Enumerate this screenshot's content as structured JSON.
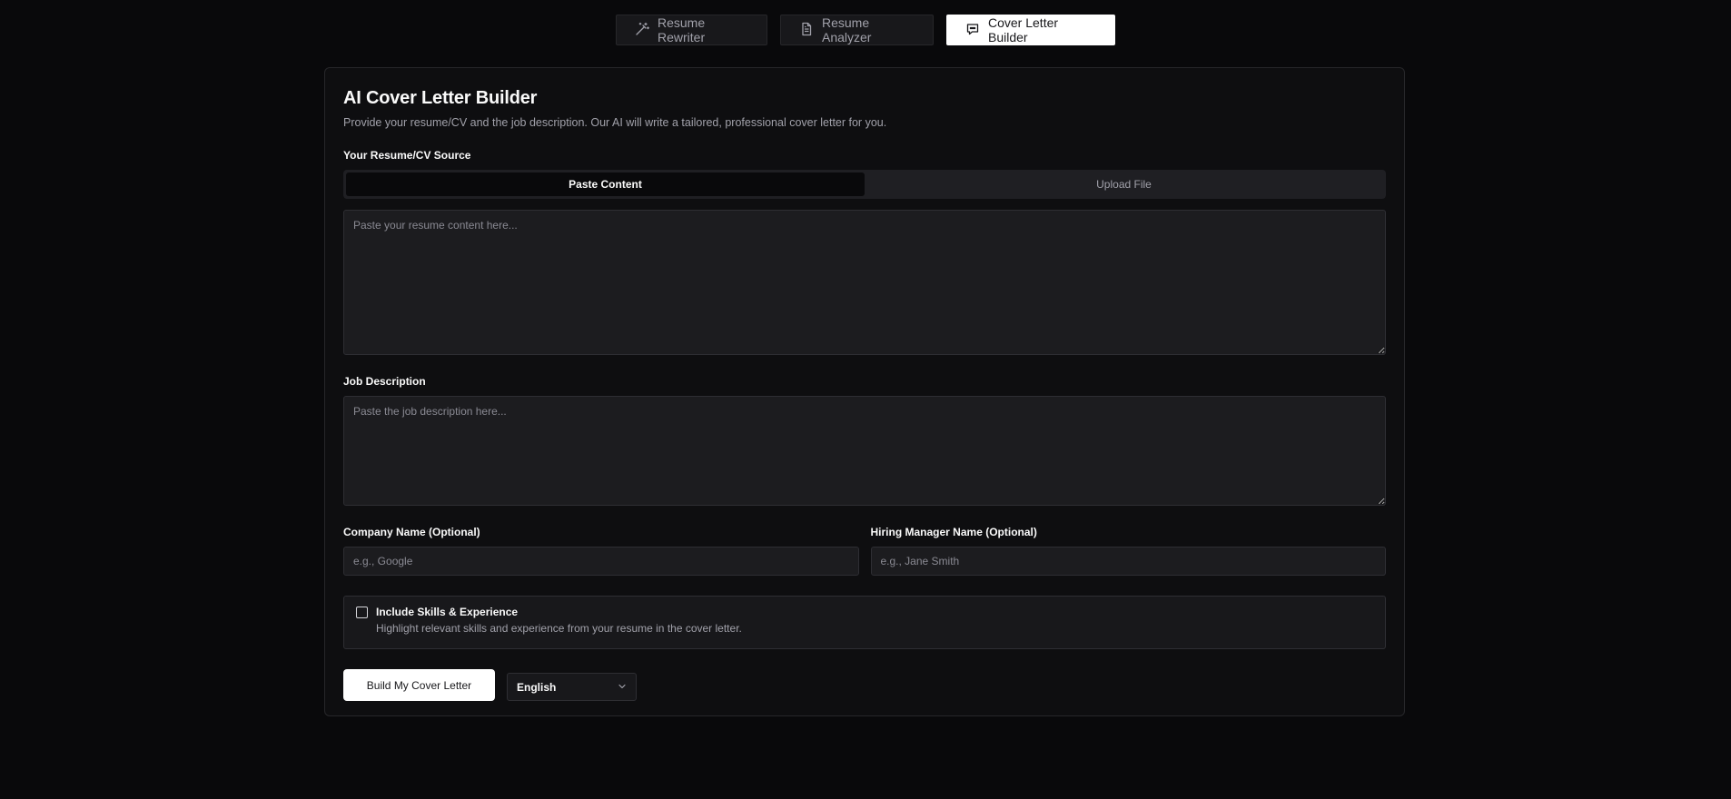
{
  "tabs": [
    {
      "label": "Resume Rewriter",
      "icon": "magic-wand-icon",
      "active": false
    },
    {
      "label": "Resume Analyzer",
      "icon": "document-icon",
      "active": false
    },
    {
      "label": "Cover Letter Builder",
      "icon": "chat-bubble-icon",
      "active": true
    }
  ],
  "card": {
    "title": "AI Cover Letter Builder",
    "subtitle": "Provide your resume/CV and the job description. Our AI will write a tailored, professional cover letter for you."
  },
  "resume_source": {
    "label": "Your Resume/CV Source",
    "options": [
      "Paste Content",
      "Upload File"
    ],
    "selected": "Paste Content",
    "placeholder": "Paste your resume content here...",
    "value": ""
  },
  "job_description": {
    "label": "Job Description",
    "placeholder": "Paste the job description here...",
    "value": ""
  },
  "company": {
    "label": "Company Name (Optional)",
    "placeholder": "e.g., Google",
    "value": ""
  },
  "hiring_manager": {
    "label": "Hiring Manager Name (Optional)",
    "placeholder": "e.g., Jane Smith",
    "value": ""
  },
  "skills_option": {
    "title": "Include Skills & Experience",
    "description": "Highlight relevant skills and experience from your resume in the cover letter.",
    "checked": false
  },
  "actions": {
    "build_label": "Build My Cover Letter",
    "language": "English"
  },
  "colors": {
    "background": "#09090b",
    "card": "#0e0e10",
    "accent": "#ffffff",
    "muted_text": "#a1a1aa"
  }
}
